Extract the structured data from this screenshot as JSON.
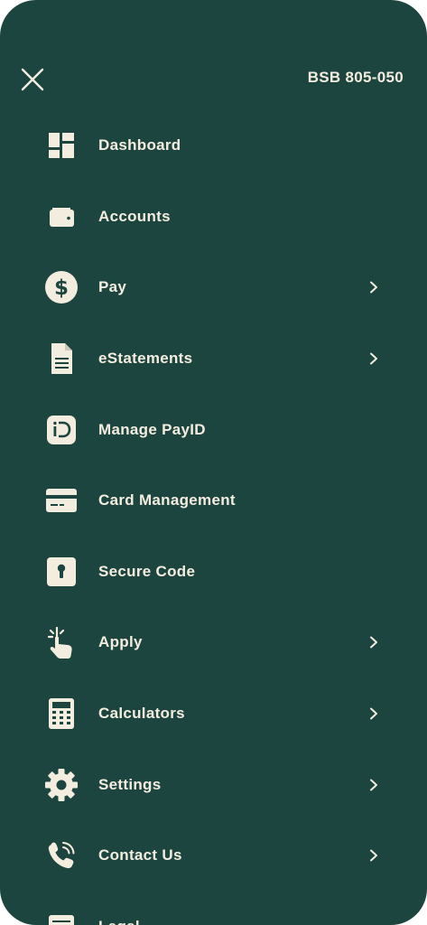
{
  "header": {
    "bsb": "BSB 805-050"
  },
  "menu": {
    "items": [
      {
        "label": "Dashboard",
        "icon": "dashboard-icon",
        "has_chevron": false
      },
      {
        "label": "Accounts",
        "icon": "wallet-icon",
        "has_chevron": false
      },
      {
        "label": "Pay",
        "icon": "dollar-icon",
        "has_chevron": true
      },
      {
        "label": "eStatements",
        "icon": "document-icon",
        "has_chevron": true
      },
      {
        "label": "Manage PayID",
        "icon": "payid-icon",
        "has_chevron": false
      },
      {
        "label": "Card Management",
        "icon": "card-icon",
        "has_chevron": false
      },
      {
        "label": "Secure Code",
        "icon": "keyhole-icon",
        "has_chevron": false
      },
      {
        "label": "Apply",
        "icon": "tap-hand-icon",
        "has_chevron": true
      },
      {
        "label": "Calculators",
        "icon": "calculator-icon",
        "has_chevron": true
      },
      {
        "label": "Settings",
        "icon": "gear-icon",
        "has_chevron": true
      },
      {
        "label": "Contact Us",
        "icon": "phone-icon",
        "has_chevron": true
      },
      {
        "label": "Legal",
        "icon": "list-icon",
        "has_chevron": false
      }
    ]
  },
  "colors": {
    "background": "#1d453f",
    "foreground": "#f3ede0"
  }
}
